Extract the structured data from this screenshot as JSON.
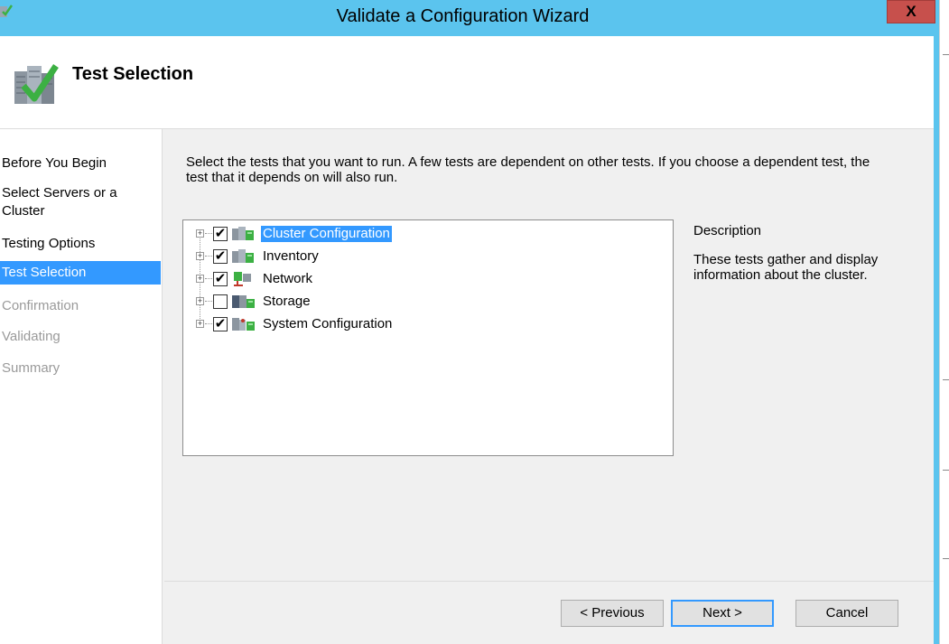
{
  "window": {
    "title": "Validate a Configuration Wizard",
    "close_label": "X"
  },
  "header": {
    "title": "Test Selection",
    "icon": "cluster-validate-icon"
  },
  "sidebar": {
    "items": [
      {
        "label": "Before You Begin",
        "state": "normal"
      },
      {
        "label": "Select Servers or a Cluster",
        "state": "normal"
      },
      {
        "label": "Testing Options",
        "state": "normal"
      },
      {
        "label": "Test Selection",
        "state": "active"
      },
      {
        "label": "Confirmation",
        "state": "disabled"
      },
      {
        "label": "Validating",
        "state": "disabled"
      },
      {
        "label": "Summary",
        "state": "disabled"
      }
    ]
  },
  "main": {
    "instructions": "Select the tests that you want to run.  A few tests are dependent on other tests.  If you choose a dependent test, the test that it depends on will also run.",
    "tree": [
      {
        "label": "Cluster Configuration",
        "checked": true,
        "selected": true,
        "expander": "+"
      },
      {
        "label": "Inventory",
        "checked": true,
        "selected": false,
        "expander": "+"
      },
      {
        "label": "Network",
        "checked": true,
        "selected": false,
        "expander": "+"
      },
      {
        "label": "Storage",
        "checked": false,
        "selected": false,
        "expander": "+"
      },
      {
        "label": "System Configuration",
        "checked": true,
        "selected": false,
        "expander": "+"
      }
    ],
    "check_glyph": "✔",
    "description": {
      "heading": "Description",
      "text": "These tests gather and display information about the cluster."
    }
  },
  "buttons": {
    "previous": "< Previous",
    "next": "Next >",
    "cancel": "Cancel"
  },
  "colors": {
    "titlebar": "#5bc4ee",
    "selection": "#3399ff",
    "close": "#c7504c"
  }
}
